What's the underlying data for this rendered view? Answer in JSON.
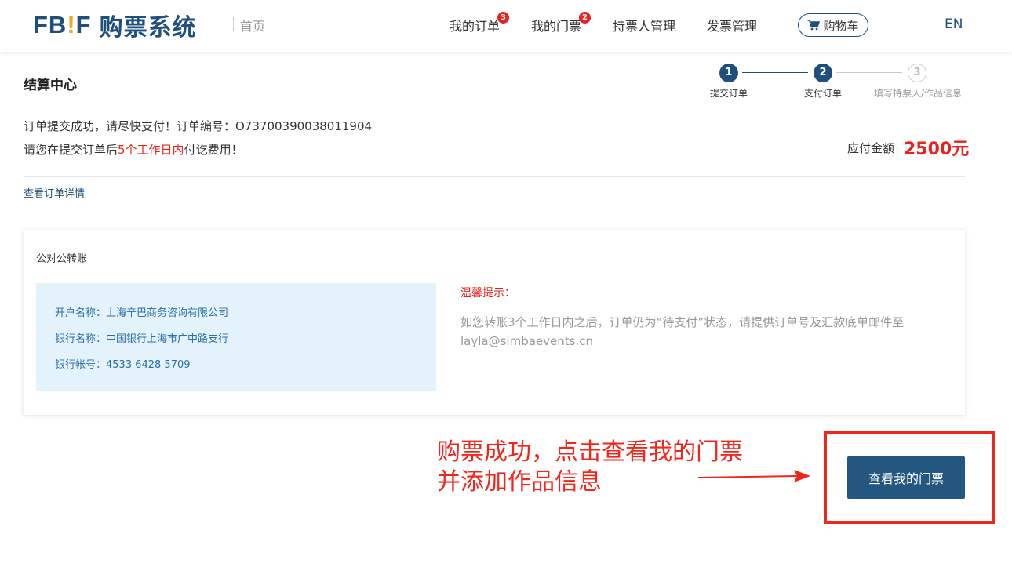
{
  "header": {
    "logo_text_fbif_a": "FB",
    "logo_text_excl": "!",
    "logo_text_fbif_b": "F",
    "logo_text_cn": "购票系统",
    "home_label": "首页",
    "nav": [
      {
        "label": "我的订单",
        "badge": "3"
      },
      {
        "label": "我的门票",
        "badge": "2"
      },
      {
        "label": "持票人管理"
      },
      {
        "label": "发票管理"
      }
    ],
    "cart_label": "购物车",
    "cart_icon": "cart-icon",
    "lang_label": "EN"
  },
  "page": {
    "title": "结算中心"
  },
  "steps": [
    {
      "number": "1",
      "label": "提交订单",
      "state": "done"
    },
    {
      "number": "2",
      "label": "支付订单",
      "state": "current"
    },
    {
      "number": "3",
      "label": "填写持票人/作品信息",
      "state": "pending"
    }
  ],
  "order": {
    "line1": "订单提交成功，请尽快支付！订单编号：O73700390038011904",
    "line2_prefix": "请您在提交订单后",
    "line2_highlight": "5个工作日内",
    "line2_suffix": "付讫费用！",
    "amount_label": "应付金额",
    "amount_value": "2500元",
    "detail_link": "查看订单详情"
  },
  "transfer": {
    "title": "公对公转账",
    "account_name": "开户名称：上海辛巴商务咨询有限公司",
    "bank_name": "银行名称：中国银行上海市广中路支行",
    "account_no": "银行帐号：4533 6428 5709",
    "tips_title": "温馨提示：",
    "tips_text": "如您转账3个工作日内之后，订单仍为“待支付”状态，请提供订单号及汇款底单邮件至layla@simbaevents.cn"
  },
  "annotation": {
    "line1": "购票成功，点击查看我的门票",
    "line2": "并添加作品信息"
  },
  "actions": {
    "view_tickets": "查看我的门票"
  },
  "colors": {
    "brand": "#1f4f7c",
    "accent_red": "#e8231f",
    "logo_exclaim": "#f5a623",
    "bank_box_bg": "#e4f2fb",
    "button_bg": "#24577f",
    "annotation_red": "#f0261b"
  }
}
